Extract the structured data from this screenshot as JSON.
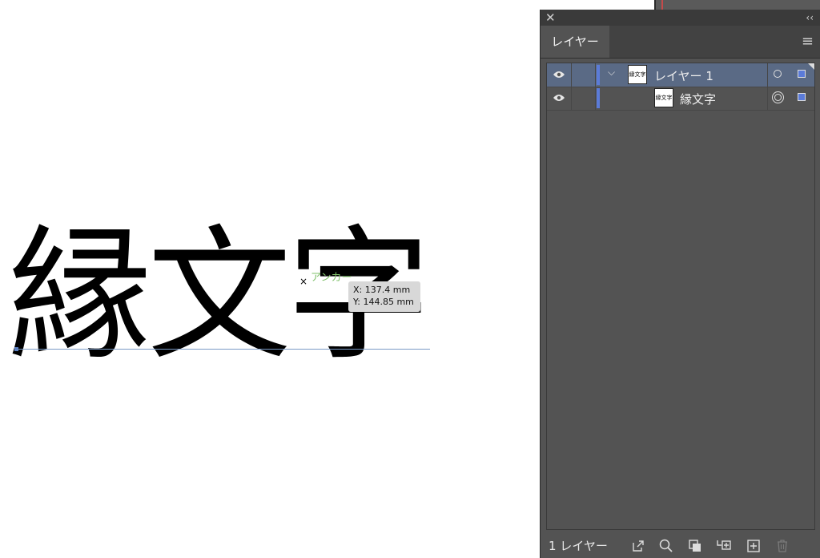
{
  "canvas": {
    "art_text": "縁文字",
    "hint_label": "アンカー",
    "tooltip": {
      "x": "X: 137.4 mm",
      "y": "Y: 144.85 mm"
    }
  },
  "panel": {
    "tab_label": "レイヤー",
    "rows": [
      {
        "thumb": "縁文字",
        "label": "レイヤー 1"
      },
      {
        "thumb": "縁文字",
        "label": "縁文字"
      }
    ],
    "footer": {
      "layer_count": "1 レイヤー"
    }
  },
  "icons": [
    "close-icon",
    "collapse-icon",
    "menu-icon",
    "eye-icon",
    "chevron-down-icon",
    "target-icon",
    "export-icon",
    "search-icon",
    "clip-mask-icon",
    "new-sublayer-icon",
    "new-layer-icon",
    "trash-icon"
  ],
  "colors": {
    "panel_bg": "#535353",
    "selection": "#5a6a85",
    "layer_color": "#5b7bd8",
    "guide": "#7b9ac7",
    "hint": "#7fc06a"
  }
}
